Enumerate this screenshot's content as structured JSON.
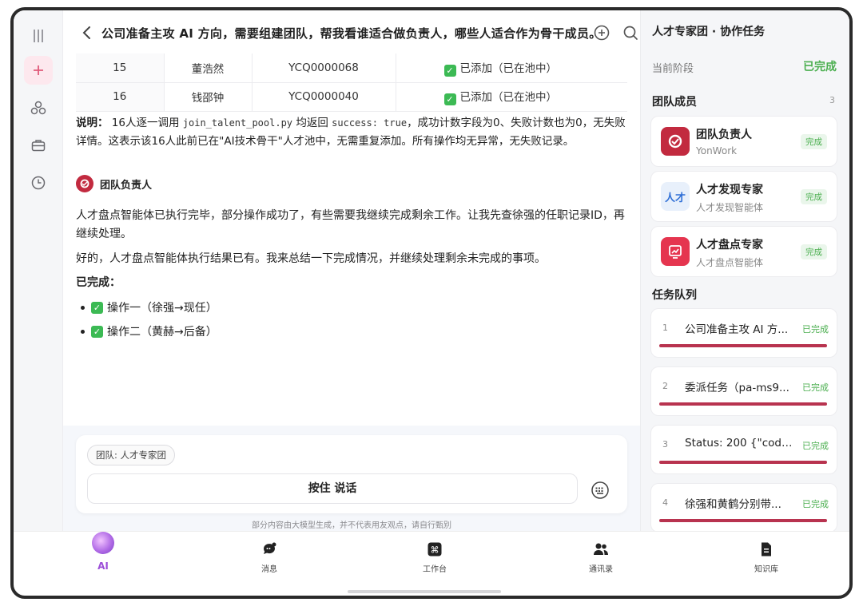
{
  "chat": {
    "title": "公司准备主攻 AI 方向，需要组建团队，帮我看谁适合做负责人，哪些人适合作为骨干成员。",
    "rows": [
      {
        "index": "15",
        "name": "董浩然",
        "id": "YCQ0000068",
        "status": "已添加（已在池中）"
      },
      {
        "index": "16",
        "name": "钱邵钟",
        "id": "YCQ0000040",
        "status": "已添加（已在池中）"
      }
    ],
    "note": {
      "label": "说明：",
      "t1": " 16人逐一调用 ",
      "code1": "join_talent_pool.py",
      "t2": " 均返回 ",
      "code2": "success: true",
      "t3": "，成功计数字段为0、失败计数也为0，无失败详情。这表示该16人此前已在\"AI技术骨干\"人才池中，无需重复添加。所有操作均无异常，无失败记录。"
    },
    "agent_name": "团队负责人",
    "para1": "人才盘点智能体已执行完毕，部分操作成功了，有些需要我继续完成剩余工作。让我先查徐强的任职记录ID，再继续处理。",
    "para2": "好的，人才盘点智能体执行结果已有。我来总结一下完成情况，并继续处理剩余未完成的事项。",
    "done_heading": "已完成：",
    "bullets": [
      "操作一（徐强→现任）",
      "操作二（黄赫→后备）"
    ]
  },
  "composer": {
    "team_chip": "团队: 人才专家团",
    "hold_button": "按住 说话",
    "disclaimer": "部分内容由大模型生成，并不代表用友观点，请自行甄别"
  },
  "panel": {
    "title": "人才专家团 · 协作任务",
    "stage_label": "当前阶段",
    "stage_value": "已完成",
    "members_title": "团队成员",
    "members_count": "3",
    "members": [
      {
        "name": "团队负责人",
        "sub": "YonWork",
        "status": "完成",
        "icon": "yonwork-logo-icon"
      },
      {
        "name": "人才发现专家",
        "sub": "人才发现智能体",
        "status": "完成",
        "icon": "talent-discovery-icon"
      },
      {
        "name": "人才盘点专家",
        "sub": "人才盘点智能体",
        "status": "完成",
        "icon": "talent-inventory-icon"
      }
    ],
    "tasks_title": "任务队列",
    "tasks": [
      {
        "num": "1",
        "title": "公司准备主攻 AI 方...",
        "status": "已完成",
        "progress": 1.0
      },
      {
        "num": "2",
        "title": "委派任务（pa-ms9...",
        "status": "已完成",
        "progress": 1.0
      },
      {
        "num": "3",
        "title": "Status: 200 {\"code...",
        "status": "已完成",
        "progress": 1.0
      },
      {
        "num": "4",
        "title": "徐强和黄鹤分别带...",
        "status": "已完成",
        "progress": 1.0
      }
    ]
  },
  "nav": {
    "items": [
      {
        "label": "AI",
        "icon": "ai-orb-icon"
      },
      {
        "label": "消息",
        "icon": "message-icon"
      },
      {
        "label": "工作台",
        "icon": "workbench-icon"
      },
      {
        "label": "通讯录",
        "icon": "contacts-icon"
      },
      {
        "label": "知识库",
        "icon": "knowledge-icon"
      }
    ]
  },
  "colors": {
    "accent": "#c22a3f",
    "success": "#4caf50",
    "ai_purple": "#9c4ed8"
  }
}
